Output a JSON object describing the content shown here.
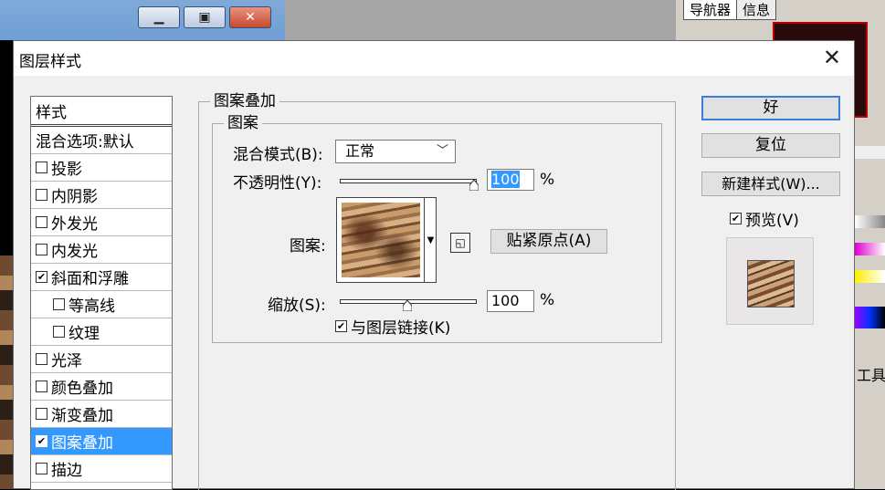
{
  "background": {
    "panel_tabs": [
      "导航器",
      "信息"
    ],
    "side_label": "工具"
  },
  "dialog": {
    "title": "图层样式",
    "close_icon": "close-icon"
  },
  "styles_list": {
    "header": "样式",
    "blend_default": "混合选项:默认",
    "items": [
      {
        "label": "投影",
        "checked": false
      },
      {
        "label": "内阴影",
        "checked": false
      },
      {
        "label": "外发光",
        "checked": false
      },
      {
        "label": "内发光",
        "checked": false
      },
      {
        "label": "斜面和浮雕",
        "checked": true
      },
      {
        "label": "等高线",
        "checked": false
      },
      {
        "label": "纹理",
        "checked": false
      },
      {
        "label": "光泽",
        "checked": false
      },
      {
        "label": "颜色叠加",
        "checked": false
      },
      {
        "label": "渐变叠加",
        "checked": false
      },
      {
        "label": "图案叠加",
        "checked": true
      },
      {
        "label": "描边",
        "checked": false
      }
    ]
  },
  "pattern_overlay": {
    "group_title": "图案叠加",
    "sub_group_title": "图案",
    "blend_mode_label": "混合模式(B):",
    "blend_mode_value": "正常",
    "opacity_label": "不透明性(Y):",
    "opacity_value": "100",
    "percent": "%",
    "pattern_label": "图案:",
    "snap_origin_button": "贴紧原点(A)",
    "scale_label": "缩放(S):",
    "scale_value": "100",
    "link_label": "与图层链接(K)"
  },
  "buttons": {
    "ok": "好",
    "reset": "复位",
    "new_style": "新建样式(W)...",
    "preview_label": "预览(V)"
  }
}
